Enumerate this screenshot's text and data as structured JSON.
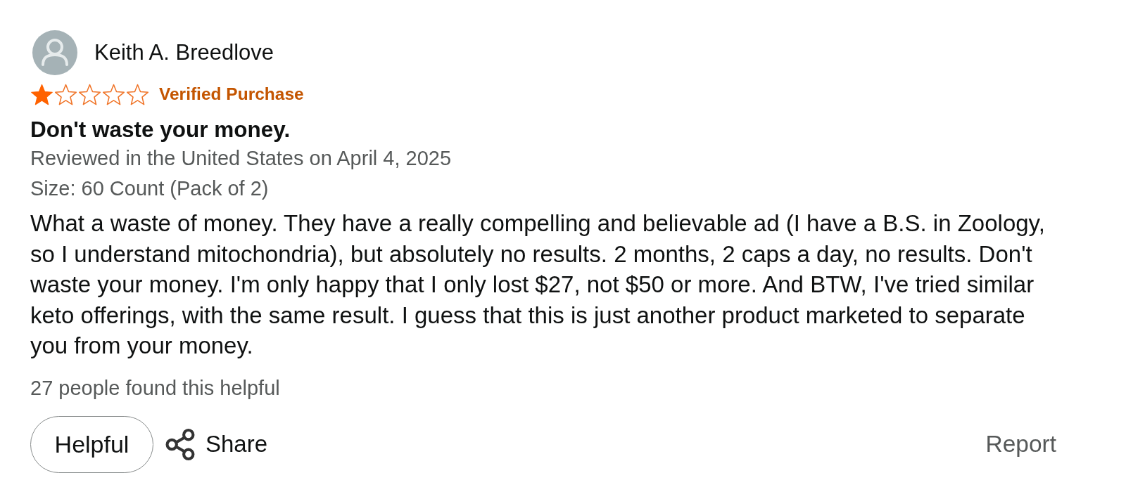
{
  "reviewer": {
    "name": "Keith A. Breedlove"
  },
  "rating": {
    "stars": 1
  },
  "badge": "Verified Purchase",
  "title": "Don't waste your money.",
  "meta": "Reviewed in the United States on April 4, 2025",
  "variant": "Size: 60 Count (Pack of 2)",
  "body": "What a waste of money. They have a really compelling and believable ad (I have a B.S. in Zoology, so I understand mitochondria), but absolutely no results. 2 months, 2 caps a day, no results. Don't waste your money. I'm only happy that I only lost $27, not $50 or more. And BTW, I've tried similar keto offerings, with the same result. I guess that this is just another product marketed to separate you from your money.",
  "helpful_count": "27 people found this helpful",
  "actions": {
    "helpful": "Helpful",
    "share": "Share",
    "report": "Report"
  }
}
